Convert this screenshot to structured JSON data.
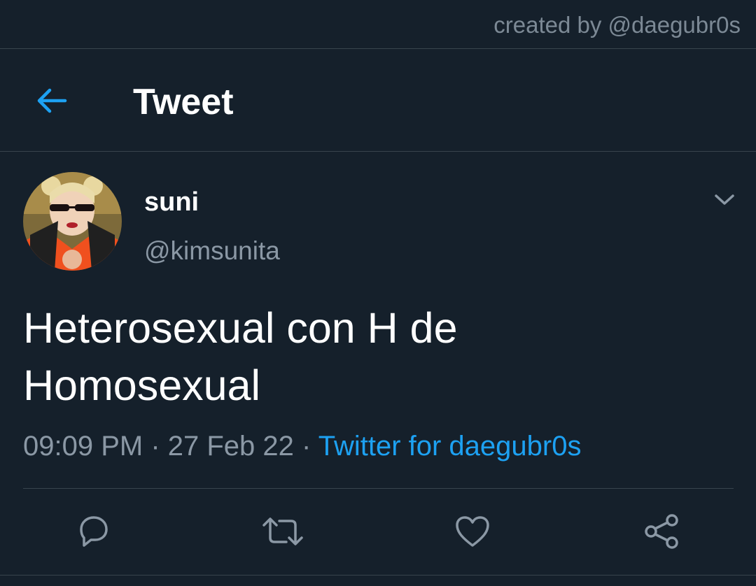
{
  "watermark": "created by @daegubr0s",
  "header": {
    "title": "Tweet",
    "back_icon": "arrow-left-icon"
  },
  "tweet": {
    "display_name": "suni",
    "handle": "@kimsunita",
    "text_line1": "Heterosexual con H de",
    "text_line2": "Homosexual",
    "time": "09:09 PM",
    "separator": " · ",
    "date": "27 Feb 22",
    "source": "Twitter for daegubr0s"
  },
  "actions": [
    "reply-icon",
    "retweet-icon",
    "like-icon",
    "share-icon"
  ],
  "colors": {
    "background": "#15202b",
    "accent": "#1da1f2",
    "secondary_text": "#8b98a5",
    "divider": "#38444d"
  }
}
